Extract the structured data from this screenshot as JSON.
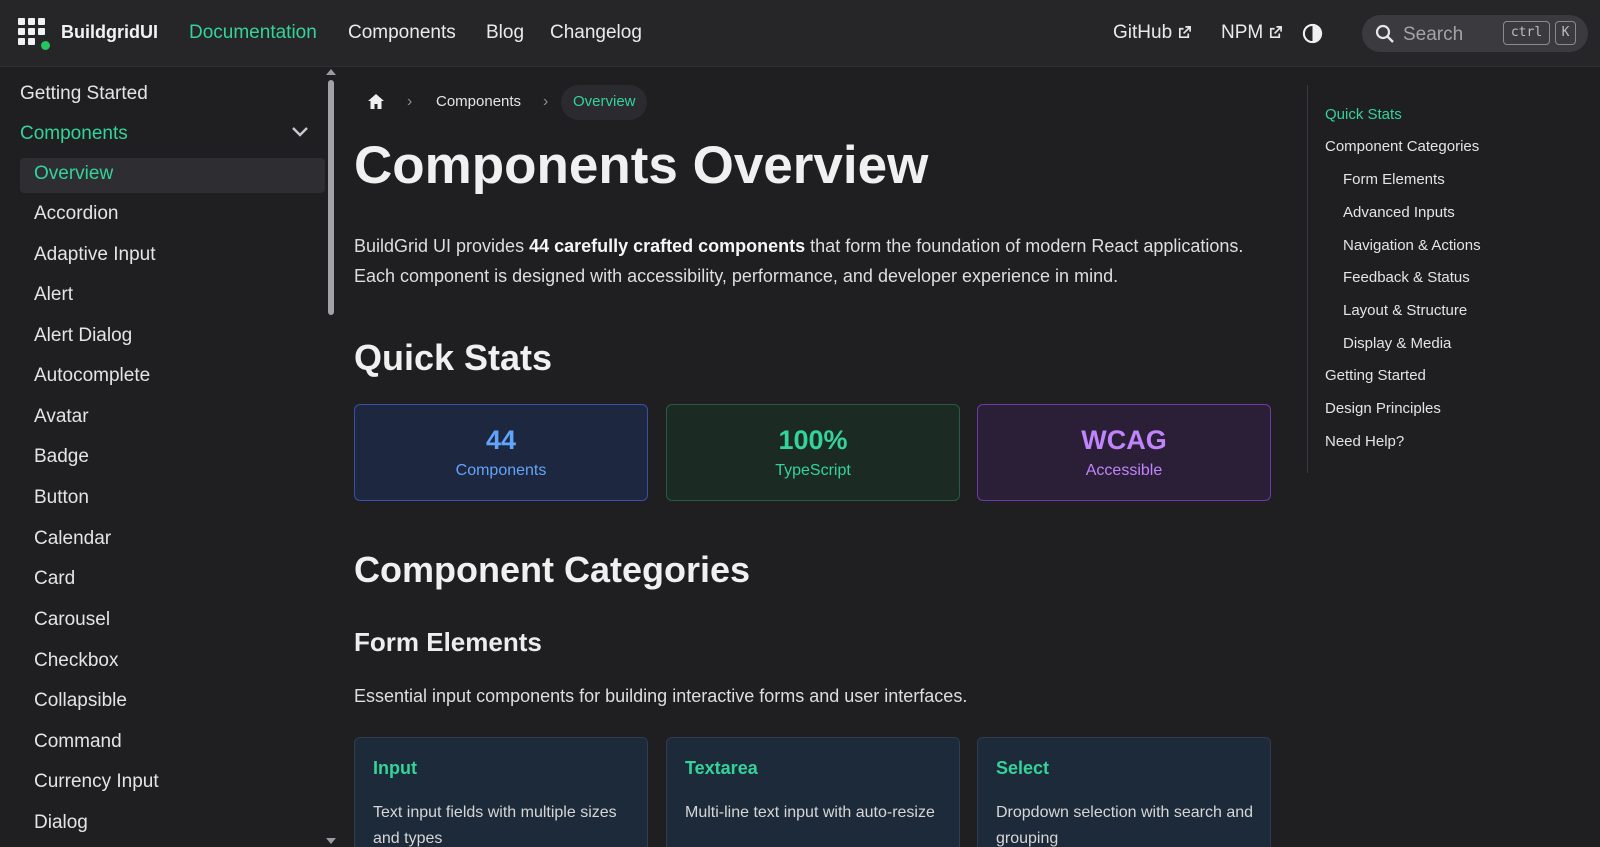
{
  "header": {
    "brand": "BuildgridUI",
    "nav": [
      "Documentation",
      "Components",
      "Blog",
      "Changelog"
    ],
    "active_nav": "Documentation",
    "external": [
      "GitHub",
      "NPM"
    ],
    "search_placeholder": "Search",
    "shortcut": [
      "ctrl",
      "K"
    ],
    "accent_color": "#34d399"
  },
  "sidebar": {
    "top": [
      "Getting Started",
      "Components"
    ],
    "components": [
      "Overview",
      "Accordion",
      "Adaptive Input",
      "Alert",
      "Alert Dialog",
      "Autocomplete",
      "Avatar",
      "Badge",
      "Button",
      "Calendar",
      "Card",
      "Carousel",
      "Checkbox",
      "Collapsible",
      "Command",
      "Currency Input",
      "Dialog"
    ],
    "selected": "Overview"
  },
  "breadcrumb": [
    "Components",
    "Overview"
  ],
  "page": {
    "title": "Components Overview",
    "intro_before": "BuildGrid UI provides ",
    "intro_bold": "44 carefully crafted components",
    "intro_after": " that form the foundation of modern React applications. Each component is designed with accessibility, performance, and developer experience in mind.",
    "quick_stats_heading": "Quick Stats",
    "stats": [
      {
        "value": "44",
        "label": "Components",
        "color": "#60a5fa"
      },
      {
        "value": "100%",
        "label": "TypeScript",
        "color": "#34d399"
      },
      {
        "value": "WCAG",
        "label": "Accessible",
        "color": "#c084fc"
      }
    ],
    "categories_heading": "Component Categories",
    "form_heading": "Form Elements",
    "form_desc": "Essential input components for building interactive forms and user interfaces.",
    "cards": [
      {
        "title": "Input",
        "desc": "Text input fields with multiple sizes and types"
      },
      {
        "title": "Textarea",
        "desc": "Multi-line text input with auto-resize"
      },
      {
        "title": "Select",
        "desc": "Dropdown selection with search and grouping"
      }
    ]
  },
  "toc": {
    "items": [
      "Quick Stats",
      "Component Categories",
      "Form Elements",
      "Advanced Inputs",
      "Navigation & Actions",
      "Feedback & Status",
      "Layout & Structure",
      "Display & Media",
      "Getting Started",
      "Design Principles",
      "Need Help?"
    ],
    "active": "Quick Stats"
  }
}
